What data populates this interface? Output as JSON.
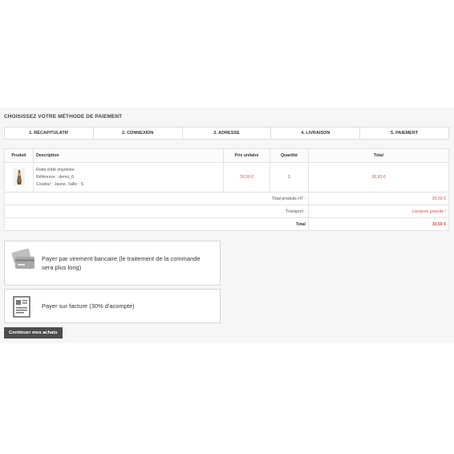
{
  "page": {
    "title": "CHOISISSEZ VOTRE MÉTHODE DE PAIEMENT"
  },
  "steps": [
    {
      "label": "1. RÉCAPITULATIF"
    },
    {
      "label": "2. CONNEXION"
    },
    {
      "label": "3. ADRESSE"
    },
    {
      "label": "4. LIVRAISON"
    },
    {
      "label": "5. PAIEMENT"
    }
  ],
  "cart": {
    "headers": {
      "product": "Produit",
      "description": "Description",
      "unit_price": "Prix unitaire",
      "quantity": "Quantité",
      "total": "Total"
    },
    "item": {
      "name": "Robe d'été imprimée",
      "reference": "Référence : demo_6",
      "attributes": "Couleur : Jaune, Taille : S",
      "unit_price": "30,50 €",
      "quantity": "1",
      "total": "30,50 €"
    },
    "summary": {
      "products_label": "Total produits HT :",
      "products_value": "30,50 €",
      "shipping_label": "Transport :",
      "shipping_value": "Livraison gratuite !",
      "total_label": "Total",
      "total_value": "30,50 €"
    }
  },
  "payment": {
    "bankwire_label": "Payer par virement bancaire (le traitement de la commande sera plus long)",
    "invoice_label": "Payer sur facture (30% d'acompte)",
    "bankwire_icon": "card-stack-icon",
    "invoice_icon": "invoice-document-icon"
  },
  "actions": {
    "continue_label": "Continuer mes achats"
  },
  "colors": {
    "price": "#d9534f",
    "button_bg": "#4d4d4d",
    "panel_bg": "#f6f6f6"
  }
}
